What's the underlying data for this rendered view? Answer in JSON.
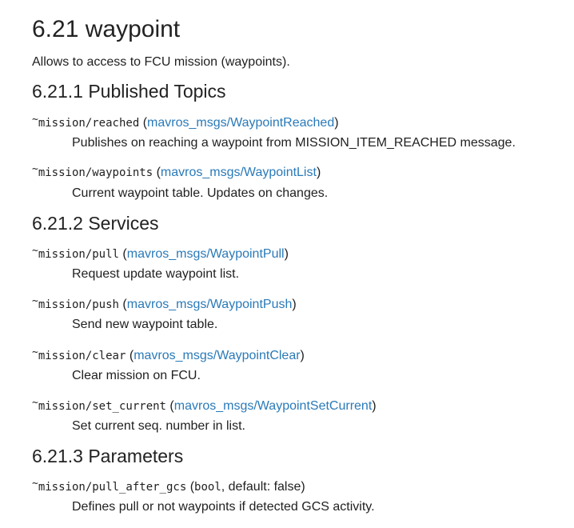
{
  "section": {
    "title": "6.21 waypoint",
    "intro": "Allows to access to FCU mission (waypoints)."
  },
  "tilde": "~",
  "published": {
    "heading": "6.21.1 Published Topics",
    "items": [
      {
        "name": "mission/reached",
        "type": "mavros_msgs/WaypointReached",
        "desc": "Publishes on reaching a waypoint from MISSION_ITEM_REACHED message."
      },
      {
        "name": "mission/waypoints",
        "type": "mavros_msgs/WaypointList",
        "desc": "Current waypoint table. Updates on changes."
      }
    ]
  },
  "services": {
    "heading": "6.21.2 Services",
    "items": [
      {
        "name": "mission/pull",
        "type": "mavros_msgs/WaypointPull",
        "desc": "Request update waypoint list."
      },
      {
        "name": "mission/push",
        "type": "mavros_msgs/WaypointPush",
        "desc": "Send new waypoint table."
      },
      {
        "name": "mission/clear",
        "type": "mavros_msgs/WaypointClear",
        "desc": "Clear mission on FCU."
      },
      {
        "name": "mission/set_current",
        "type": "mavros_msgs/WaypointSetCurrent",
        "desc": "Set current seq. number in list."
      }
    ]
  },
  "parameters": {
    "heading": "6.21.3 Parameters",
    "items": [
      {
        "name": "mission/pull_after_gcs",
        "type": "bool",
        "default_text": "default: false",
        "desc": "Defines pull or not waypoints if detected GCS activity."
      }
    ]
  },
  "colors": {
    "link": "#2a7ab8",
    "text": "#1f1f1f"
  }
}
